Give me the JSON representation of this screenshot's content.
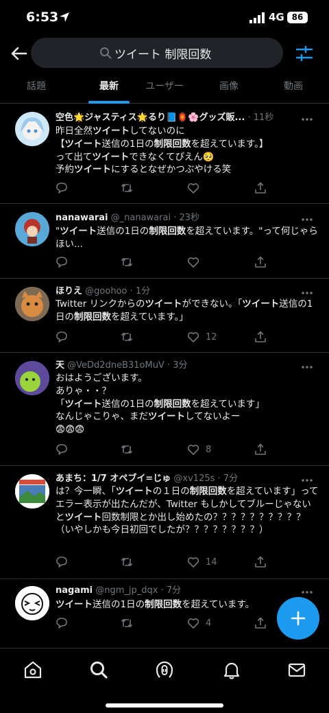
{
  "status": {
    "time": "6:53",
    "network": "4G",
    "battery": "86"
  },
  "search": {
    "query": "ツイート 制限回数"
  },
  "tabs": [
    {
      "label": "話題"
    },
    {
      "label": "最新"
    },
    {
      "label": "ユーザー"
    },
    {
      "label": "画像"
    },
    {
      "label": "動画"
    }
  ],
  "tweets": [
    {
      "name": "空色🌟ジャスティス🌟るり📘🏮🌸グッズ販...",
      "handle": "",
      "time": "· 11秒",
      "body_html": "昨日全然<b>ツイート</b>してないのに\n【<b>ツイート</b>送信の1日の<b>制限回数</b>を超えています。】\nって出て<b>ツイート</b>できなくてぴえん🥺\n予約<b>ツイート</b>にするとなぜかつぶやける笑",
      "likes": ""
    },
    {
      "name": "nanawarai",
      "handle": "@_nanawarai",
      "time": "· 23秒",
      "body_html": "\"<b>ツイート</b>送信の1日の<b>制限回数</b>を超えています。\"って何じゃらほい...",
      "likes": ""
    },
    {
      "name": "ほりえ",
      "handle": "@goohoo",
      "time": "· 1分",
      "body_html": "Twitter リンクからの<b>ツイート</b>ができない。「<b>ツイート</b>送信の1日の<b>制限回数</b>を超えています。」",
      "likes": "12"
    },
    {
      "name": "天",
      "handle": "@VeDd2dneB31oMuV",
      "time": "· 3分",
      "body_html": "おはようございます。\nありゃ・・？\n「<b>ツイート</b>送信の1日の<b>制限回数</b>を超えています」\nなんじゃこりゃ、まだ<b>ツイート</b>してないよー\n😨😨😨",
      "likes": "8"
    },
    {
      "name": "あまち：1/7 オペブイ=じゅ",
      "handle": "@xv125s",
      "time": "· 7分",
      "body_html": "は？今一瞬、「<b>ツイート</b>の１日の<b>制限回数</b>を超えています」ってエラー表示が出たんだが、Twitter もしかしてブルーじゃないと<b>ツイート</b>回数制限とか出し始めたの？？？？？？？？？？（いやしかも今日初回でしたが？？？？？？？？）",
      "likes": "14"
    },
    {
      "name": "nagami",
      "handle": "@ngm_jp_dqx",
      "time": "· 7分",
      "body_html": "<b>ツイート</b>送信の1日の<b>制限回数</b>を超えています。",
      "likes": "4"
    }
  ],
  "colors": {
    "accent": "#1d9bf0",
    "background": "#000000",
    "text_secondary": "#71767b"
  },
  "icons": [
    "back-arrow-icon",
    "search-icon",
    "filter-sliders-icon",
    "more-dots-icon",
    "reply-icon",
    "retweet-icon",
    "like-icon",
    "share-icon",
    "compose-plus-icon",
    "home-icon",
    "explore-icon",
    "spaces-icon",
    "notifications-icon",
    "messages-icon"
  ]
}
